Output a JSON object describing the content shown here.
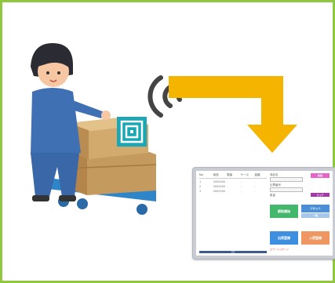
{
  "illustration": {
    "worker_icon": "worker-pushing-cart-icon",
    "tag_icon": "rfid-tag-icon",
    "signal_icon": "wireless-signal-icon",
    "arrow_icon": "elbow-arrow-down-icon"
  },
  "colors": {
    "frame_border": "#8fc840",
    "arrow": "#f4b400",
    "tag": "#1ba7b5",
    "cart": "#2e86c9",
    "box": "#c49a5e"
  },
  "tablet": {
    "table": {
      "headers": [
        "No",
        "商品",
        "数量",
        "ケース",
        "金額"
      ],
      "rows": [
        [
          "1",
          "0000000000",
          "-",
          "-",
          "-"
        ],
        [
          "2",
          "0000000000",
          "-",
          "-",
          "-"
        ],
        [
          "3",
          "0000000000",
          "-",
          "-",
          "-"
        ]
      ],
      "footer": "合計"
    },
    "side": {
      "label_1": "商品名",
      "label_2": "伝票番号",
      "label_3": "数量",
      "pink_button": "新規",
      "purple_button": "クリア",
      "green_button": "読取開始",
      "blue_button": "リセット",
      "light_blue_button": "一覧",
      "blue_button_2": "出荷登録",
      "orange_button": "入荷登録",
      "red_text": "エラーメッセージ"
    }
  }
}
